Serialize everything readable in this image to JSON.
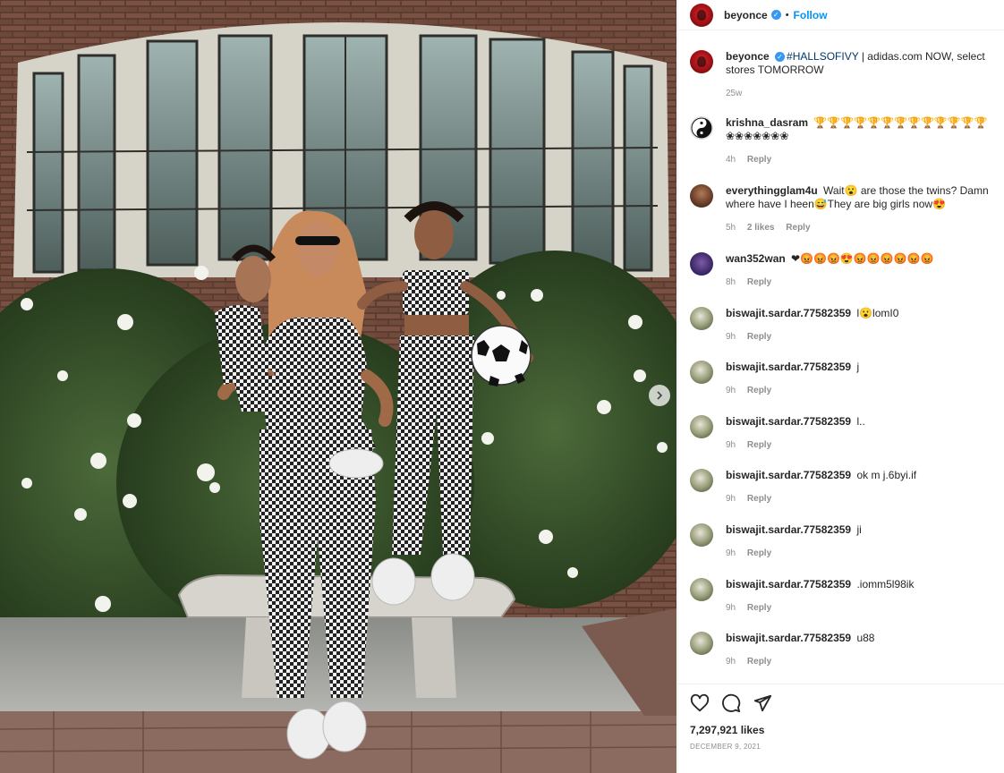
{
  "post": {
    "author": "beyonce",
    "follow_label": "Follow",
    "dot": "•",
    "caption_username": "beyonce",
    "caption_hashtag": "#HALLSOFIVY",
    "caption_text": " | adidas.com NOW, select stores TOMORROW",
    "caption_time": "25w",
    "likes": "7,297,921 likes",
    "date": "December 9, 2021"
  },
  "comments": [
    {
      "username": "krishna_dasram",
      "text": "🏆🏆🏆🏆🏆🏆🏆🏆🏆🏆🏆🏆🏆 ❀❀❀❀❀❀❀",
      "time": "4h",
      "reply": "Reply",
      "avatar_icon": "yin-yang-icon"
    },
    {
      "username": "everythingglam4u",
      "text": "Wait😮 are those the twins? Damn where have I heen😅They are big girls now😍",
      "time": "5h",
      "likes": "2 likes",
      "reply": "Reply",
      "avatar_icon": "woman-avatar"
    },
    {
      "username": "wan352wan",
      "text": "❤😡😡😡😍😡😡😡😡😡😡",
      "time": "8h",
      "reply": "Reply",
      "avatar_icon": "purple-avatar"
    },
    {
      "username": "biswajit.sardar.77582359",
      "text": "l😮lomI0",
      "time": "9h",
      "reply": "Reply",
      "avatar_icon": "green-avatar"
    },
    {
      "username": "biswajit.sardar.77582359",
      "text": "j",
      "time": "9h",
      "reply": "Reply",
      "avatar_icon": "green-avatar"
    },
    {
      "username": "biswajit.sardar.77582359",
      "text": "l..",
      "time": "9h",
      "reply": "Reply",
      "avatar_icon": "green-avatar"
    },
    {
      "username": "biswajit.sardar.77582359",
      "text": "ok m j.6byi.if",
      "time": "9h",
      "reply": "Reply",
      "avatar_icon": "green-avatar"
    },
    {
      "username": "biswajit.sardar.77582359",
      "text": "ji",
      "time": "9h",
      "reply": "Reply",
      "avatar_icon": "green-avatar"
    },
    {
      "username": "biswajit.sardar.77582359",
      "text": ".iomm5l98ik",
      "time": "9h",
      "reply": "Reply",
      "avatar_icon": "green-avatar"
    },
    {
      "username": "biswajit.sardar.77582359",
      "text": "u88",
      "time": "9h",
      "reply": "Reply",
      "avatar_icon": "green-avatar"
    }
  ],
  "colors": {
    "link": "#0095f6",
    "hashtag": "#00376b",
    "muted": "#8e8e8e",
    "verified": "#3897f0"
  },
  "icons": [
    "heart-icon",
    "comment-icon",
    "share-icon",
    "verified-icon",
    "chevron-right-icon"
  ]
}
